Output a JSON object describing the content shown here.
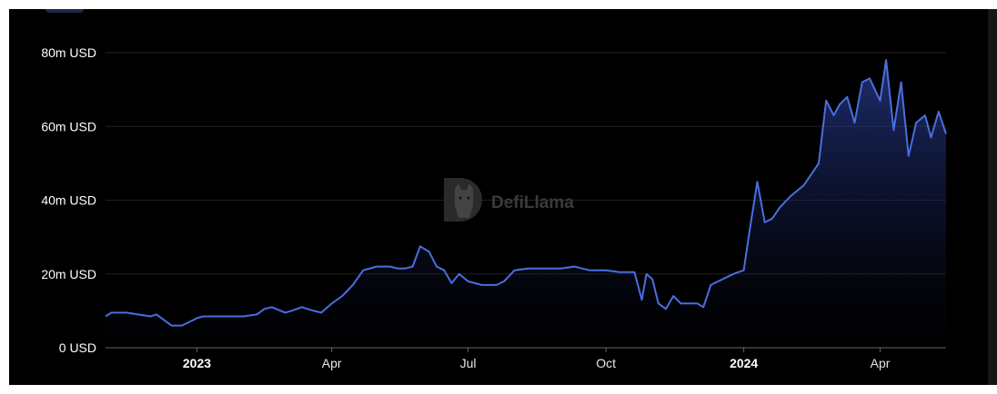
{
  "chart_data": {
    "type": "area",
    "title": "",
    "xlabel": "",
    "ylabel": "",
    "watermark": "DefiLlama",
    "unit": "USD",
    "ylim": [
      0,
      80
    ],
    "y_ticks": [
      "0 USD",
      "20m USD",
      "40m USD",
      "60m USD",
      "80m USD"
    ],
    "xlim": [
      "2022-11-01",
      "2024-05-15"
    ],
    "x_ticks": [
      {
        "date": "2023-01-01",
        "label": "2023",
        "bold": true
      },
      {
        "date": "2023-04-01",
        "label": "Apr",
        "bold": false
      },
      {
        "date": "2023-07-01",
        "label": "Jul",
        "bold": false
      },
      {
        "date": "2023-10-01",
        "label": "Oct",
        "bold": false
      },
      {
        "date": "2024-01-01",
        "label": "2024",
        "bold": true
      },
      {
        "date": "2024-04-01",
        "label": "Apr",
        "bold": false
      }
    ],
    "grid": true,
    "legend": "none",
    "line_color": "#4a6ee0",
    "fill_color": "#1a2a6a",
    "series": [
      {
        "values_unit": "million USD",
        "x": [
          "2022-11-01",
          "2022-11-05",
          "2022-11-15",
          "2022-12-01",
          "2022-12-05",
          "2022-12-15",
          "2022-12-22",
          "2023-01-01",
          "2023-01-05",
          "2023-01-20",
          "2023-02-01",
          "2023-02-10",
          "2023-02-15",
          "2023-02-20",
          "2023-03-01",
          "2023-03-05",
          "2023-03-12",
          "2023-03-20",
          "2023-03-25",
          "2023-04-01",
          "2023-04-08",
          "2023-04-15",
          "2023-04-22",
          "2023-05-01",
          "2023-05-10",
          "2023-05-15",
          "2023-05-20",
          "2023-05-25",
          "2023-05-30",
          "2023-06-05",
          "2023-06-10",
          "2023-06-15",
          "2023-06-20",
          "2023-06-25",
          "2023-07-01",
          "2023-07-10",
          "2023-07-20",
          "2023-07-25",
          "2023-08-01",
          "2023-08-10",
          "2023-08-20",
          "2023-09-01",
          "2023-09-10",
          "2023-09-20",
          "2023-10-01",
          "2023-10-10",
          "2023-10-20",
          "2023-10-25",
          "2023-10-28",
          "2023-11-01",
          "2023-11-05",
          "2023-11-10",
          "2023-11-15",
          "2023-11-20",
          "2023-12-01",
          "2023-12-05",
          "2023-12-10",
          "2023-12-15",
          "2023-12-20",
          "2023-12-25",
          "2024-01-01",
          "2024-01-05",
          "2024-01-10",
          "2024-01-15",
          "2024-01-20",
          "2024-01-25",
          "2024-02-01",
          "2024-02-10",
          "2024-02-20",
          "2024-02-25",
          "2024-03-01",
          "2024-03-05",
          "2024-03-10",
          "2024-03-15",
          "2024-03-20",
          "2024-03-25",
          "2024-04-01",
          "2024-04-05",
          "2024-04-10",
          "2024-04-15",
          "2024-04-20",
          "2024-04-25",
          "2024-05-01",
          "2024-05-05",
          "2024-05-10",
          "2024-05-15"
        ],
        "values": [
          8.5,
          9.5,
          9.5,
          8.5,
          9,
          6,
          6,
          8,
          8.5,
          8.5,
          8.5,
          9,
          10.5,
          11,
          9.5,
          10,
          11,
          10,
          9.5,
          12,
          14,
          17,
          21,
          22,
          22,
          21.5,
          21.5,
          22,
          27.5,
          26,
          22,
          21,
          17.5,
          20,
          18,
          17,
          17,
          18,
          21,
          21.5,
          21.5,
          21.5,
          22,
          21,
          21,
          20.5,
          20.5,
          13,
          20,
          18.5,
          12,
          10.5,
          14,
          12,
          12,
          11,
          17,
          18,
          19,
          20,
          21,
          32,
          45,
          34,
          35,
          38,
          41,
          44,
          50,
          67,
          63,
          66,
          68,
          61,
          72,
          73,
          67,
          78,
          59,
          72,
          52,
          61,
          63,
          57,
          64,
          58
        ]
      }
    ]
  }
}
